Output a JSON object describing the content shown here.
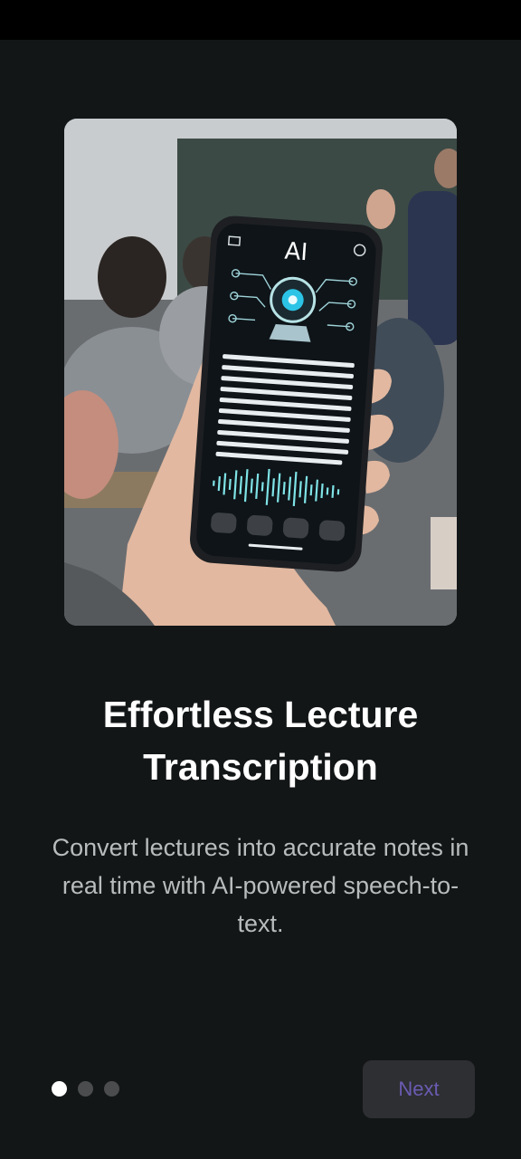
{
  "onboarding": {
    "title": "Effortless Lecture Transcription",
    "description": "Convert lectures into accurate notes in real time with AI-powered speech-to-text.",
    "next_label": "Next",
    "page_indicator": {
      "total": 3,
      "current": 1
    }
  },
  "hero": {
    "phone_header_label": "AI"
  },
  "colors": {
    "background": "#131617",
    "title": "#ffffff",
    "description": "#b9bcbd",
    "button_background": "#2d2f32",
    "button_text": "#6b5bb2",
    "dot_active": "#ffffff",
    "dot_inactive": "#4a4c4e",
    "waveform": "#7fe3e6"
  }
}
